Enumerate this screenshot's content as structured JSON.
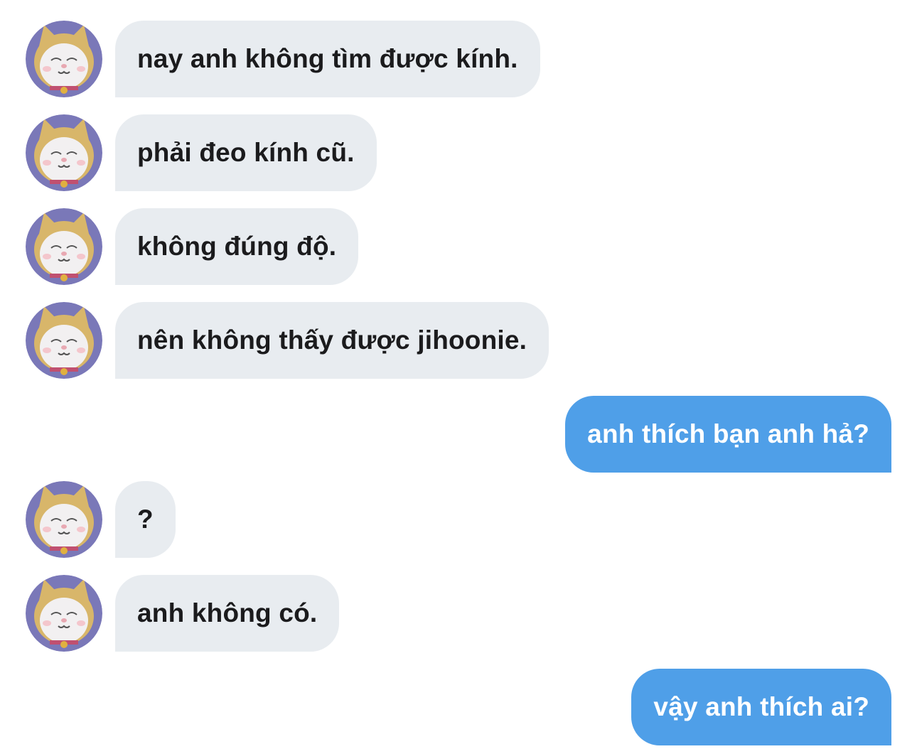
{
  "colors": {
    "incoming_bubble": "#e8ecf0",
    "outgoing_bubble": "#4f9fe8",
    "incoming_text": "#1b1b1d",
    "outgoing_text": "#ffffff"
  },
  "contact": {
    "avatar_icon": "cat-character-avatar-icon"
  },
  "messages": [
    {
      "direction": "incoming",
      "text": "nay anh không tìm được kính."
    },
    {
      "direction": "incoming",
      "text": "phải đeo kính cũ."
    },
    {
      "direction": "incoming",
      "text": "không đúng độ."
    },
    {
      "direction": "incoming",
      "text": "nên không thấy được jihoonie."
    },
    {
      "direction": "outgoing",
      "text": "anh thích bạn anh hả?"
    },
    {
      "direction": "incoming",
      "text": "?"
    },
    {
      "direction": "incoming",
      "text": "anh không có."
    },
    {
      "direction": "outgoing",
      "text": "vậy anh thích ai?"
    }
  ]
}
